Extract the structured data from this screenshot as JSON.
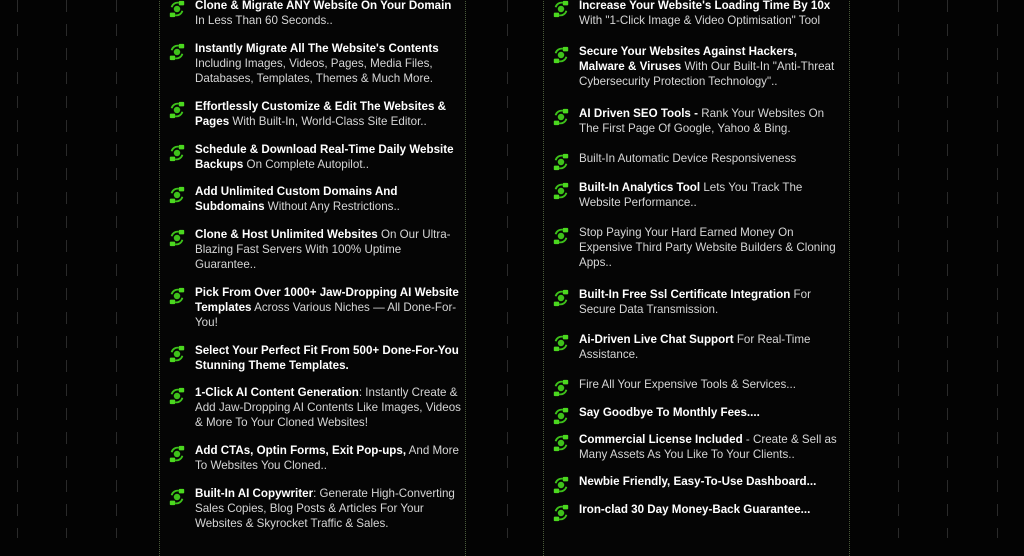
{
  "colors": {
    "background": "#030303",
    "accent": "#3ec21a",
    "text": "#d6d6d6",
    "bold_text": "#ffffff"
  },
  "icon_semantic": "cloning-arrows-icon",
  "left_features": [
    {
      "bold": "Clone & Migrate ANY Website On Your Domain",
      "rest": " In Less Than 60 Seconds.."
    },
    {
      "bold": "Instantly Migrate All The Website's Contents",
      "rest": " Including Images, Videos, Pages, Media Files, Databases, Templates, Themes & Much More."
    },
    {
      "bold": "Effortlessly Customize & Edit The Websites & Pages",
      "rest": " With Built-In, World-Class Site Editor.."
    },
    {
      "bold": "Schedule & Download Real-Time Daily Website Backups",
      "rest": " On Complete Autopilot.."
    },
    {
      "bold": "Add Unlimited Custom Domains And Subdomains",
      "rest": " Without Any Restrictions.."
    },
    {
      "bold": "Clone & Host Unlimited Websites",
      "rest": " On Our Ultra-Blazing Fast Servers With 100% Uptime Guarantee.."
    },
    {
      "bold": "Pick From Over 1000+ Jaw-Dropping AI Website Templates",
      "rest": " Across Various Niches — All Done-For-You!"
    },
    {
      "bold": "Select Your Perfect Fit From 500+ Done-For-You Stunning Theme Templates.",
      "rest": ""
    },
    {
      "bold": "1-Click AI Content Generation",
      "rest": ": Instantly Create & Add Jaw-Dropping AI Contents Like Images, Videos & More To Your Cloned Websites!"
    },
    {
      "bold": "Add CTAs, Optin Forms, Exit Pop-ups,",
      "rest": " And More To Websites You Cloned.."
    },
    {
      "bold": "Built-In AI Copywriter",
      "rest": ": Generate High-Converting Sales Copies, Blog Posts & Articles For Your Websites & Skyrocket Traffic & Sales."
    }
  ],
  "right_features": [
    {
      "bold": "Increase Your  Website's Loading Time By 10x",
      "rest": " With \"1-Click Image & Video Optimisation\" Tool"
    },
    {
      "bold": "Secure Your Websites Against Hackers, Malware & Viruses",
      "rest": " With Our Built-In \"Anti-Threat Cybersecurity Protection Technology\".."
    },
    {
      "bold": "AI Driven SEO Tools -",
      "rest": " Rank Your Websites On The First Page Of Google, Yahoo & Bing."
    },
    {
      "bold": "",
      "rest": "Built-In Automatic Device Responsiveness"
    },
    {
      "bold": "Built-In Analytics Tool",
      "rest": " Lets You Track The Website Performance.."
    },
    {
      "bold": "",
      "rest": "Stop Paying Your Hard Earned Money On Expensive Third Party Website Builders & Cloning Apps.."
    },
    {
      "bold": "Built-In Free Ssl Certificate Integration",
      "rest": " For Secure Data Transmission."
    },
    {
      "bold": "Ai-Driven Live Chat Support",
      "rest": " For Real-Time Assistance."
    },
    {
      "bold": "",
      "rest": "Fire All Your Expensive Tools & Services..."
    },
    {
      "bold": "Say Goodbye To Monthly Fees....",
      "rest": ""
    },
    {
      "bold": "Commercial License Included",
      "rest": " - Create & Sell as Many Assets As You Like To Your Clients.."
    },
    {
      "bold": "Newbie Friendly, Easy-To-Use Dashboard...",
      "rest": ""
    },
    {
      "bold": "Iron-clad 30 Day Money-Back Guarantee...",
      "rest": ""
    }
  ]
}
